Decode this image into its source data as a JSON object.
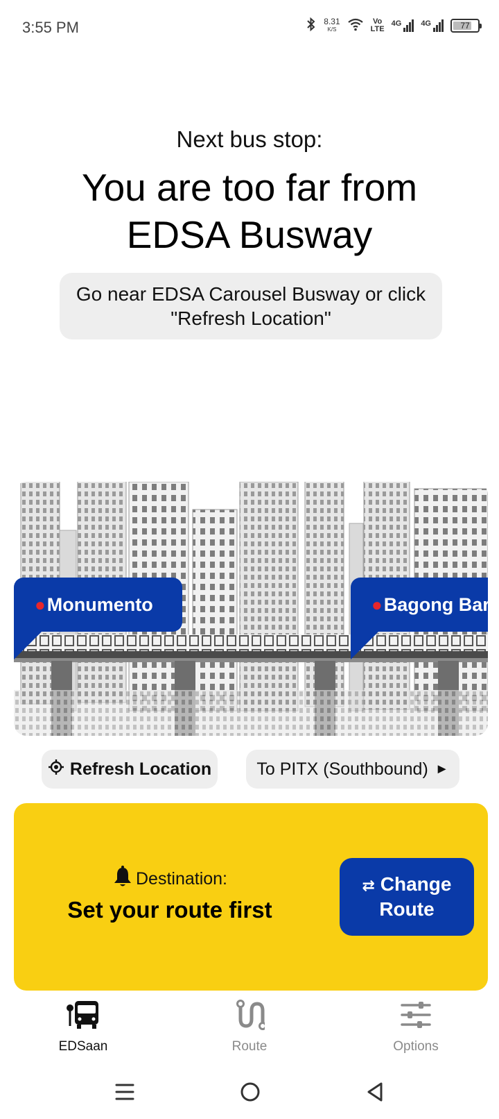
{
  "status_bar": {
    "time": "3:55 PM",
    "net_speed": "8.31",
    "net_speed_unit": "K/S",
    "volte_top": "Vo",
    "volte_bottom": "LTE",
    "signal1_label": "4G",
    "signal2_label": "4G",
    "battery_level": "77",
    "battery_fraction": 0.77,
    "icons": [
      "bluetooth-icon",
      "wifi-icon",
      "signal-icon",
      "battery-icon"
    ]
  },
  "header": {
    "next_label": "Next bus stop:",
    "main_message": "You are too far from EDSA Busway",
    "hint": "Go near EDSA Carousel Busway or click \"Refresh Location\""
  },
  "scene": {
    "stops": [
      {
        "label": "Monumento"
      },
      {
        "label": "Bagong Barrio"
      }
    ],
    "accent_color": "#0a3aa8",
    "pin_color": "#e8262b"
  },
  "controls": {
    "refresh_label": "Refresh Location",
    "direction_label": "To PITX (Southbound)",
    "direction_arrow": "►"
  },
  "destination": {
    "label": "Destination:",
    "value": "Set your route first",
    "change_icon": "⇄",
    "change_label": "Change Route",
    "panel_color": "#f9cf12"
  },
  "bottom_nav": {
    "items": [
      {
        "label": "EDSaan",
        "icon": "bus-stop-icon",
        "active": true
      },
      {
        "label": "Route",
        "icon": "route-icon",
        "active": false
      },
      {
        "label": "Options",
        "icon": "sliders-icon",
        "active": false
      }
    ]
  },
  "system_nav": {
    "icons": [
      "menu-icon",
      "home-icon",
      "back-icon"
    ]
  }
}
